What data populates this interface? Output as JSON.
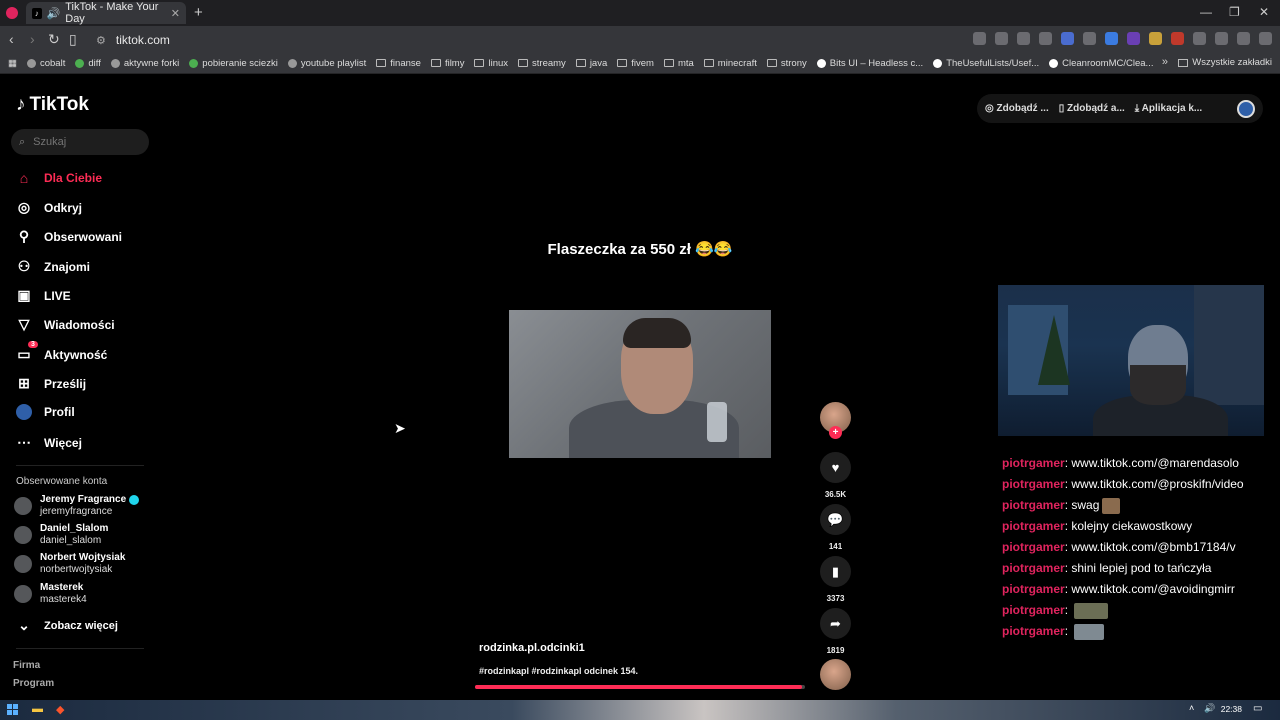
{
  "browser": {
    "tab_title": "TikTok - Make Your Day",
    "url": "tiktok.com",
    "bookmarks": [
      "cobalt",
      "diff",
      "aktywne forki",
      "pobieranie sciezki",
      "youtube playlist",
      "finanse",
      "filmy",
      "linux",
      "streamy",
      "java",
      "fivem",
      "mta",
      "minecraft",
      "strony",
      "Bits UI – Headless c...",
      "TheUsefulLists/Usef...",
      "CleanroomMC/Clea..."
    ],
    "all_bookmarks": "Wszystkie zakładki"
  },
  "sidebar": {
    "logo": "TikTok",
    "search_placeholder": "Szukaj",
    "nav": [
      {
        "label": "Dla Ciebie",
        "icon": "home-icon"
      },
      {
        "label": "Odkryj",
        "icon": "compass-icon"
      },
      {
        "label": "Obserwowani",
        "icon": "user-plus-icon"
      },
      {
        "label": "Znajomi",
        "icon": "friends-icon"
      },
      {
        "label": "LIVE",
        "icon": "live-icon"
      },
      {
        "label": "Wiadomości",
        "icon": "send-icon"
      },
      {
        "label": "Aktywność",
        "icon": "inbox-icon",
        "badge": "3"
      },
      {
        "label": "Prześlij",
        "icon": "upload-icon"
      },
      {
        "label": "Profil",
        "icon": "profile-icon"
      },
      {
        "label": "Więcej",
        "icon": "more-icon"
      }
    ],
    "followed_title": "Obserwowane konta",
    "accounts": [
      {
        "name": "Jeremy Fragrance",
        "username": "jeremyfragrance"
      },
      {
        "name": "Daniel_Slalom",
        "username": "daniel_slalom"
      },
      {
        "name": "Norbert Wojtysiak",
        "username": "norbertwojtysiak"
      },
      {
        "name": "Masterek",
        "username": "masterek4"
      }
    ],
    "see_more": "Zobacz więcej",
    "footer": [
      "Firma",
      "Program"
    ]
  },
  "top_buttons": [
    "Zdobądź ...",
    "Zdobądź a...",
    "Aplikacja k..."
  ],
  "video": {
    "caption": "Flaszeczka za 550 zł 😂😂",
    "author": "rodzinka.pl.odcinki1",
    "tags": "#rodzinkapl #rodzinkapl odcinek 154.",
    "progress": 0.99,
    "likes": "36.5K",
    "comments": "141",
    "saves": "3373",
    "shares": "1819"
  },
  "chat": [
    {
      "user": "piotrgamer",
      "text": "www.tiktok.com/@marendasolo"
    },
    {
      "user": "piotrgamer",
      "text": "www.tiktok.com/@proskifn/video"
    },
    {
      "user": "piotrgamer",
      "text": "swag",
      "emote": "e1"
    },
    {
      "user": "piotrgamer",
      "text": "kolejny ciekawostkowy"
    },
    {
      "user": "piotrgamer",
      "text": "www.tiktok.com/@bmb17184/v"
    },
    {
      "user": "piotrgamer",
      "text": "shini lepiej pod to tańczyła"
    },
    {
      "user": "piotrgamer",
      "text": "www.tiktok.com/@avoidingmirr"
    },
    {
      "user": "piotrgamer",
      "text": "",
      "emote": "e2"
    },
    {
      "user": "piotrgamer",
      "text": "",
      "emote": "e3"
    }
  ],
  "taskbar": {
    "clock": "22:38"
  },
  "colors": {
    "accent": "#fe2c55",
    "chat_user": "#e0245e"
  }
}
